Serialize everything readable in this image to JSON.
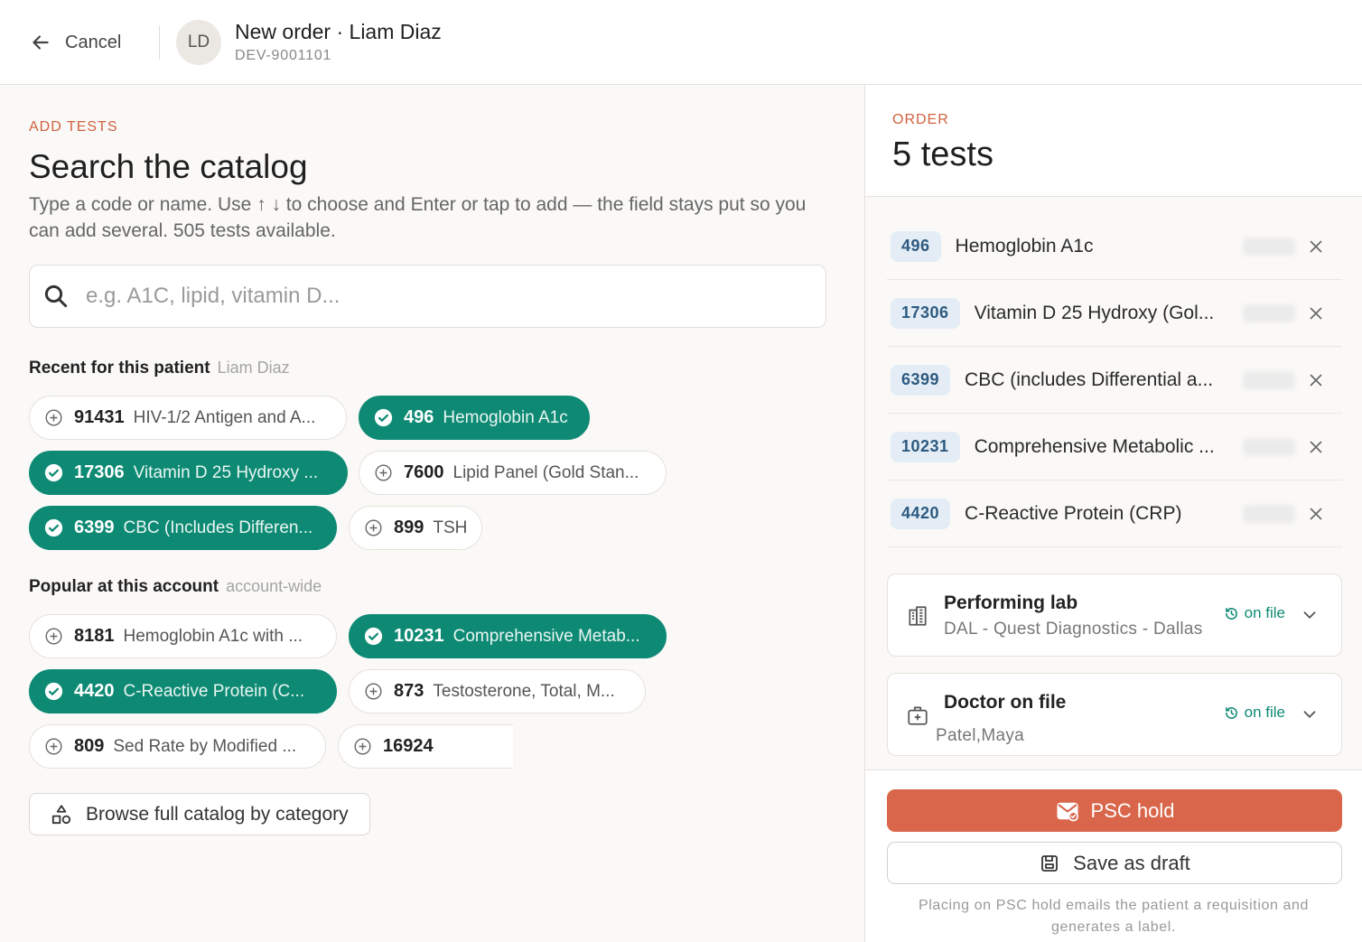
{
  "header": {
    "cancel_label": "Cancel",
    "avatar_initials": "LD",
    "title": "New order · Liam Diaz",
    "subtitle": "DEV-9001101"
  },
  "left": {
    "eyebrow": "ADD TESTS",
    "title": "Search the catalog",
    "description": "Type a code or name. Use ↑ ↓ to choose and Enter or tap to add — the field stays put so you can add several. 505 tests available.",
    "search_placeholder": "e.g. A1C, lipid, vitamin D...",
    "recent": {
      "label": "Recent for this patient",
      "sublabel": "Liam Diaz",
      "chips": [
        {
          "code": "91431",
          "name": "HIV-1/2 Antigen and A...",
          "selected": false
        },
        {
          "code": "496",
          "name": "Hemoglobin A1c",
          "selected": true
        },
        {
          "code": "17306",
          "name": "Vitamin D 25 Hydroxy ...",
          "selected": true
        },
        {
          "code": "7600",
          "name": "Lipid Panel (Gold Stan...",
          "selected": false
        },
        {
          "code": "6399",
          "name": "CBC (Includes Differen...",
          "selected": true
        },
        {
          "code": "899",
          "name": "TSH",
          "selected": false
        }
      ]
    },
    "popular": {
      "label": "Popular at this account",
      "sublabel": "account-wide",
      "chips": [
        {
          "code": "8181",
          "name": "Hemoglobin A1c with ...",
          "selected": false
        },
        {
          "code": "10231",
          "name": "Comprehensive Metab...",
          "selected": true
        },
        {
          "code": "4420",
          "name": "C-Reactive Protein (C...",
          "selected": true
        },
        {
          "code": "873",
          "name": "Testosterone, Total, M...",
          "selected": false
        },
        {
          "code": "809",
          "name": "Sed Rate by Modified ...",
          "selected": false
        },
        {
          "code": "16924",
          "name": "",
          "selected": false
        }
      ]
    },
    "browse_label": "Browse full catalog by category"
  },
  "order": {
    "eyebrow": "ORDER",
    "title": "5 tests",
    "items": [
      {
        "code": "496",
        "name": "Hemoglobin A1c"
      },
      {
        "code": "17306",
        "name": "Vitamin D 25 Hydroxy (Gol..."
      },
      {
        "code": "6399",
        "name": "CBC (includes Differential a..."
      },
      {
        "code": "10231",
        "name": "Comprehensive Metabolic ..."
      },
      {
        "code": "4420",
        "name": "C-Reactive Protein (CRP)"
      }
    ],
    "lab": {
      "title": "Performing lab",
      "value": "DAL - Quest Diagnostics - Dallas",
      "status": "on file"
    },
    "doctor": {
      "title": "Doctor on file",
      "value": "Patel,Maya",
      "status": "on file"
    },
    "primary_label": "PSC hold",
    "secondary_label": "Save as draft",
    "note": "Placing on PSC hold emails the patient a requisition and generates a label."
  },
  "colors": {
    "accent": "#d9664a",
    "selected_chip": "#0e8a74",
    "badge_bg": "#e4edf5"
  }
}
